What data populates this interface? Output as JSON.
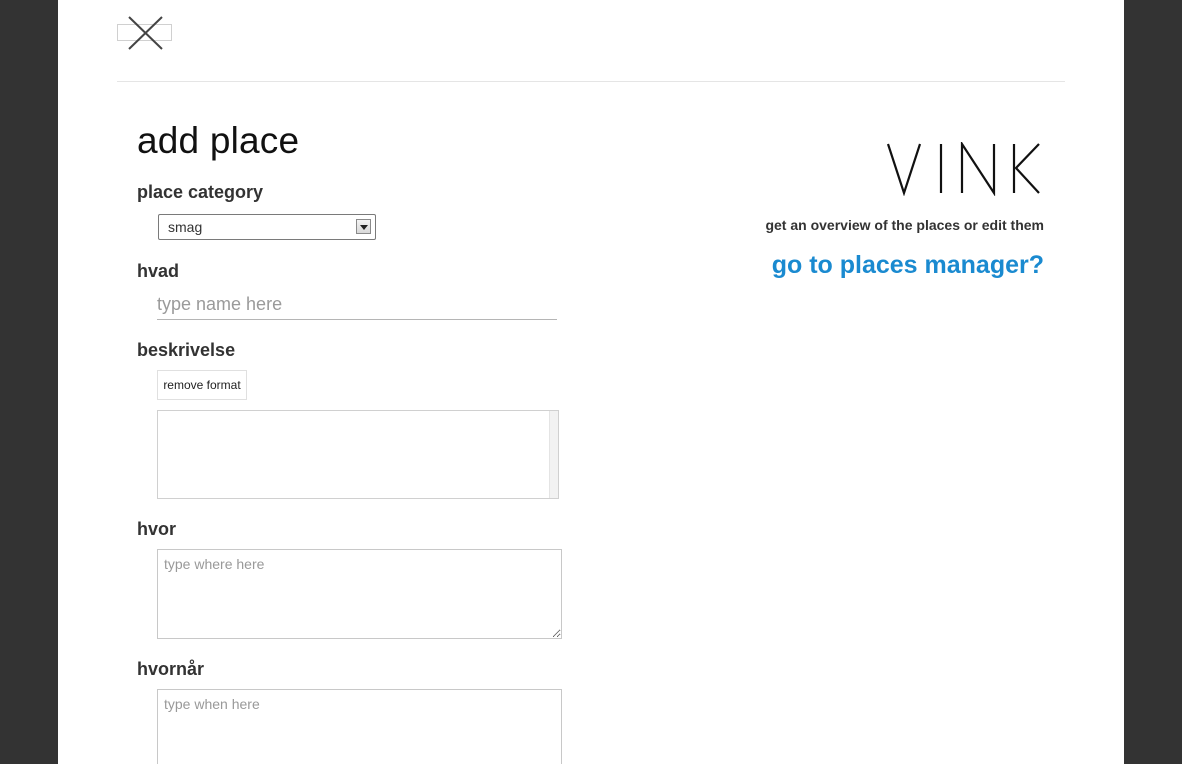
{
  "header": {
    "close_icon": "close-x-icon"
  },
  "form": {
    "title": "add place",
    "category_label": "place category",
    "category_value": "smag",
    "name_label": "hvad",
    "name_placeholder": "type name here",
    "description_label": "beskrivelse",
    "remove_format_label": "remove format",
    "where_label": "hvor",
    "where_placeholder": "type where here",
    "when_label": "hvornår",
    "when_placeholder": "type when here"
  },
  "sidebar": {
    "logo_text": "VINK",
    "overview_text": "get an overview of the places or edit them",
    "manager_link": "go to places manager?",
    "link_color": "#1a8ad0"
  }
}
